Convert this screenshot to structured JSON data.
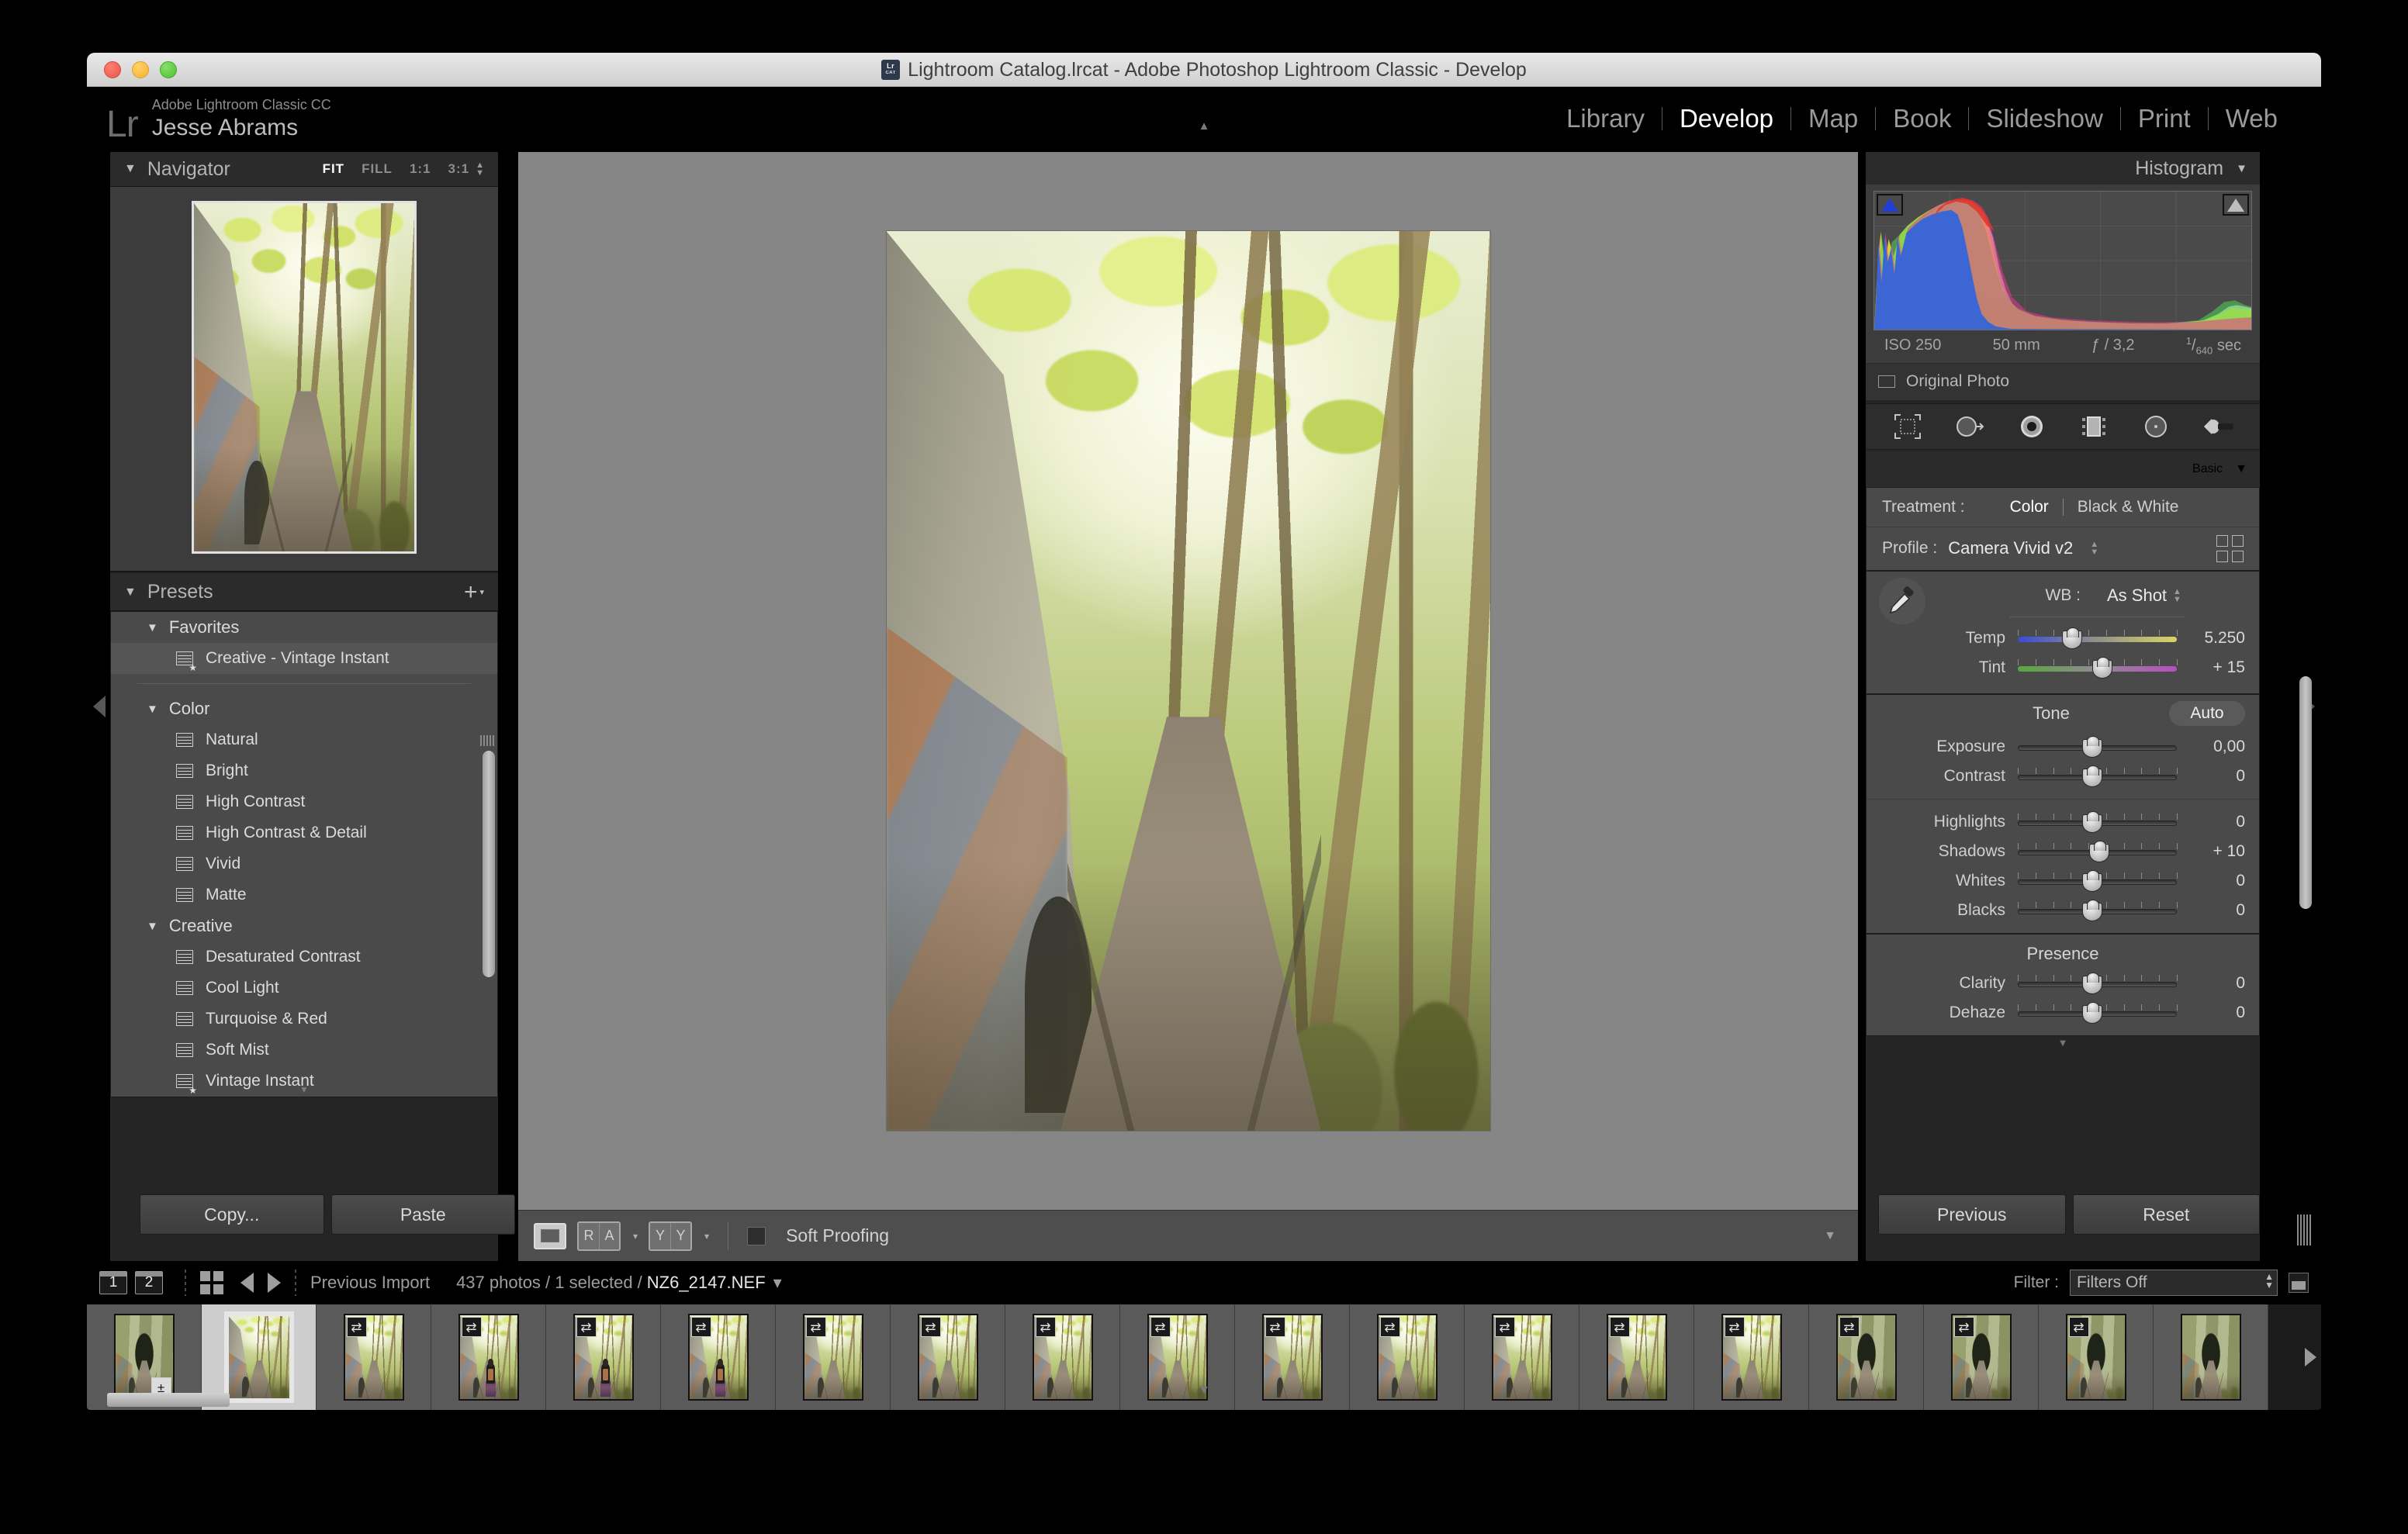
{
  "window": {
    "title": "Lightroom Catalog.lrcat - Adobe Photoshop Lightroom Classic - Develop",
    "catalog_icon_top": "Lr",
    "catalog_icon_bottom": "CAT"
  },
  "identity": {
    "logo": "Lr",
    "product": "Adobe Lightroom Classic CC",
    "user": "Jesse Abrams"
  },
  "modules": [
    {
      "label": "Library",
      "active": false
    },
    {
      "label": "Develop",
      "active": true
    },
    {
      "label": "Map",
      "active": false
    },
    {
      "label": "Book",
      "active": false
    },
    {
      "label": "Slideshow",
      "active": false
    },
    {
      "label": "Print",
      "active": false
    },
    {
      "label": "Web",
      "active": false
    }
  ],
  "navigator": {
    "title": "Navigator",
    "zoom_options": [
      {
        "label": "FIT",
        "active": true
      },
      {
        "label": "FILL",
        "active": false
      },
      {
        "label": "1:1",
        "active": false
      },
      {
        "label": "3:1",
        "active": false
      }
    ]
  },
  "presets": {
    "title": "Presets",
    "groups": [
      {
        "name": "Favorites",
        "items": [
          {
            "label": "Creative - Vintage Instant",
            "selected": true,
            "favorite": true
          }
        ]
      },
      {
        "name": "Color",
        "items": [
          {
            "label": "Natural",
            "selected": false,
            "favorite": false
          },
          {
            "label": "Bright",
            "selected": false,
            "favorite": false
          },
          {
            "label": "High Contrast",
            "selected": false,
            "favorite": false
          },
          {
            "label": "High Contrast & Detail",
            "selected": false,
            "favorite": false
          },
          {
            "label": "Vivid",
            "selected": false,
            "favorite": false
          },
          {
            "label": "Matte",
            "selected": false,
            "favorite": false
          }
        ]
      },
      {
        "name": "Creative",
        "items": [
          {
            "label": "Desaturated Contrast",
            "selected": false,
            "favorite": false
          },
          {
            "label": "Cool Light",
            "selected": false,
            "favorite": false
          },
          {
            "label": "Turquoise & Red",
            "selected": false,
            "favorite": false
          },
          {
            "label": "Soft Mist",
            "selected": false,
            "favorite": false
          },
          {
            "label": "Vintage Instant",
            "selected": false,
            "favorite": true
          }
        ]
      }
    ]
  },
  "left_buttons": {
    "copy": "Copy...",
    "paste": "Paste"
  },
  "toolbar": {
    "loupe_icon": "loupe-view",
    "before_after_label_a": "R",
    "before_after_label_b": "A",
    "compare_label_a": "Y",
    "compare_label_b": "Y",
    "soft_proofing": "Soft Proofing",
    "soft_proofing_checked": false
  },
  "histogram": {
    "title": "Histogram",
    "shadow_clipping_active": true,
    "highlight_clipping_active": false,
    "exif": {
      "iso": "ISO 250",
      "focal": "50 mm",
      "aperture": "ƒ / 3,2",
      "shutter_num": "1",
      "shutter_den": "640",
      "shutter_unit": "sec"
    },
    "original_photo": "Original Photo"
  },
  "tools": [
    "crop-overlay-icon",
    "spot-removal-icon",
    "red-eye-icon",
    "graduated-filter-icon",
    "radial-filter-icon",
    "adjustment-brush-icon"
  ],
  "basic": {
    "title": "Basic",
    "treatment_label": "Treatment :",
    "treatment_options": [
      {
        "label": "Color",
        "active": true
      },
      {
        "label": "Black & White",
        "active": false
      }
    ],
    "profile_label": "Profile :",
    "profile_value": "Camera Vivid v2",
    "wb_label": "WB :",
    "wb_value": "As Shot",
    "wb_sliders": [
      {
        "label": "Temp",
        "value": "5.250",
        "pos": 34,
        "track": "temp"
      },
      {
        "label": "Tint",
        "value": "+ 15",
        "pos": 53,
        "track": "tint"
      }
    ],
    "tone_header": "Tone",
    "auto_label": "Auto",
    "tone_sliders": [
      {
        "label": "Exposure",
        "value": "0,00",
        "pos": 47,
        "ticks": false
      },
      {
        "label": "Contrast",
        "value": "0",
        "pos": 47,
        "ticks": true
      },
      {
        "label": "Highlights",
        "value": "0",
        "pos": 47,
        "ticks": true
      },
      {
        "label": "Shadows",
        "value": "+ 10",
        "pos": 51,
        "ticks": true
      },
      {
        "label": "Whites",
        "value": "0",
        "pos": 47,
        "ticks": true
      },
      {
        "label": "Blacks",
        "value": "0",
        "pos": 47,
        "ticks": true
      }
    ],
    "presence_header": "Presence",
    "presence_sliders": [
      {
        "label": "Clarity",
        "value": "0",
        "pos": 47,
        "ticks": true
      },
      {
        "label": "Dehaze",
        "value": "0",
        "pos": 47,
        "ticks": true
      }
    ]
  },
  "right_buttons": {
    "previous": "Previous",
    "reset": "Reset"
  },
  "filmstrip_bar": {
    "screen1": "1",
    "screen2": "2",
    "grid_icon": "grid-view-icon",
    "back_icon": "go-back-icon",
    "forward_icon": "go-forward-icon",
    "source": "Previous Import",
    "count": "437 photos / 1 selected /",
    "filename": "NZ6_2147.NEF",
    "filter_label": "Filter :",
    "filter_value": "Filters Off"
  },
  "filmstrip": {
    "thumbs": [
      {
        "scene": "tunnel",
        "badge": "±",
        "badge_pos": "br",
        "active": false
      },
      {
        "scene": "path",
        "badge": "",
        "badge_pos": "",
        "active": true
      },
      {
        "scene": "path",
        "badge": "⇄",
        "badge_pos": "tl",
        "active": false
      },
      {
        "scene": "person",
        "badge": "⇄",
        "badge_pos": "tl",
        "active": false
      },
      {
        "scene": "person",
        "badge": "⇄",
        "badge_pos": "tl",
        "active": false
      },
      {
        "scene": "person",
        "badge": "⇄",
        "badge_pos": "tl",
        "active": false
      },
      {
        "scene": "path",
        "badge": "⇄",
        "badge_pos": "tl",
        "active": false
      },
      {
        "scene": "path",
        "badge": "⇄",
        "badge_pos": "tl",
        "active": false
      },
      {
        "scene": "path",
        "badge": "⇄",
        "badge_pos": "tl",
        "active": false
      },
      {
        "scene": "path",
        "badge": "⇄",
        "badge_pos": "tl",
        "active": false
      },
      {
        "scene": "path",
        "badge": "⇄",
        "badge_pos": "tl",
        "active": false
      },
      {
        "scene": "path",
        "badge": "⇄",
        "badge_pos": "tl",
        "active": false
      },
      {
        "scene": "path",
        "badge": "⇄",
        "badge_pos": "tl",
        "active": false
      },
      {
        "scene": "path",
        "badge": "⇄",
        "badge_pos": "tl",
        "active": false
      },
      {
        "scene": "path",
        "badge": "⇄",
        "badge_pos": "tl",
        "active": false
      },
      {
        "scene": "tunnel",
        "badge": "⇄",
        "badge_pos": "tl",
        "active": false
      },
      {
        "scene": "tunnel",
        "badge": "⇄",
        "badge_pos": "tl",
        "active": false
      },
      {
        "scene": "tunnel",
        "badge": "⇄",
        "badge_pos": "tl",
        "active": false
      },
      {
        "scene": "tunnel",
        "badge": "",
        "badge_pos": "",
        "active": false
      }
    ]
  }
}
